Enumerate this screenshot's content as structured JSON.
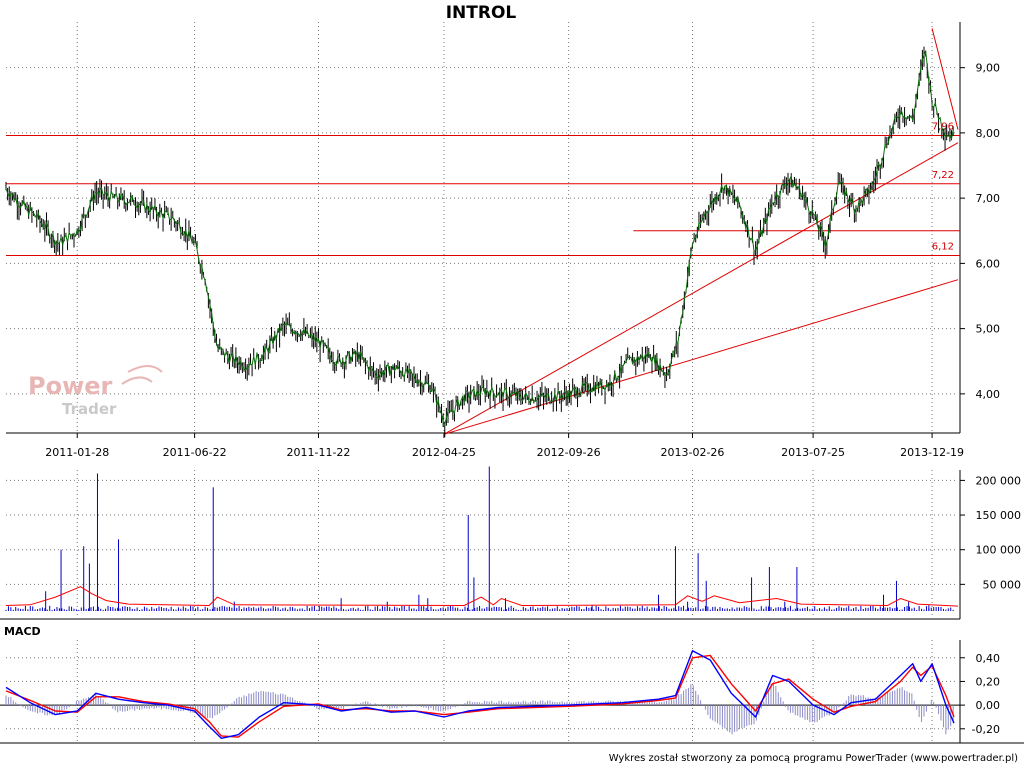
{
  "title": "INTROL",
  "footer": "Wykres został stworzony za pomocą programu PowerTrader (www.powertrader.pl)",
  "logo": {
    "line1": "Power",
    "line2": "Trader"
  },
  "macd_label": "MACD",
  "colors": {
    "price": "#0a6e0a",
    "level": "#e00000",
    "volume": "#0000c8",
    "volume_avg": "#ff0000",
    "macd": "#0000ff",
    "signal": "#ff0000",
    "hist": "#8c8cc8",
    "grid": "#777777"
  },
  "chart_data": [
    {
      "name": "price",
      "type": "line",
      "x_ticks": [
        "2011-01-28",
        "2011-06-22",
        "2011-11-22",
        "2012-04-25",
        "2012-09-26",
        "2013-02-26",
        "2013-07-25",
        "2013-12-19"
      ],
      "y_ticks": [
        "4,00",
        "5,00",
        "6,00",
        "7,00",
        "8,00",
        "9,00"
      ],
      "ylim": [
        3.4,
        9.7
      ],
      "xlim": [
        "2010-11-01",
        "2014-01-20"
      ],
      "series": [
        {
          "x": [
            "2010-11-01",
            "2010-11-20",
            "2010-12-10",
            "2011-01-05",
            "2011-01-28",
            "2011-02-20",
            "2011-03-15",
            "2011-04-10",
            "2011-05-05",
            "2011-05-25",
            "2011-06-10",
            "2011-06-22",
            "2011-07-05",
            "2011-07-20",
            "2011-08-05",
            "2011-08-25",
            "2011-09-15",
            "2011-10-10",
            "2011-11-01",
            "2011-11-22",
            "2011-12-15",
            "2012-01-10",
            "2012-02-01",
            "2012-02-25",
            "2012-03-20",
            "2012-04-10",
            "2012-04-25",
            "2012-05-20",
            "2012-06-15",
            "2012-07-10",
            "2012-08-05",
            "2012-08-30",
            "2012-09-26",
            "2012-10-20",
            "2012-11-15",
            "2012-12-10",
            "2013-01-05",
            "2013-01-25",
            "2013-02-08",
            "2013-02-26",
            "2013-03-15",
            "2013-04-05",
            "2013-04-25",
            "2013-05-15",
            "2013-06-05",
            "2013-06-25",
            "2013-07-10",
            "2013-07-25",
            "2013-08-10",
            "2013-08-25",
            "2013-09-15",
            "2013-10-05",
            "2013-10-25",
            "2013-11-10",
            "2013-11-25",
            "2013-12-10",
            "2013-12-19",
            "2014-01-05",
            "2014-01-15"
          ],
          "y": [
            7.15,
            6.9,
            6.7,
            6.3,
            6.5,
            7.1,
            7.0,
            6.95,
            6.8,
            6.7,
            6.5,
            6.3,
            5.8,
            4.7,
            4.55,
            4.45,
            4.6,
            5.05,
            4.95,
            4.8,
            4.5,
            4.6,
            4.3,
            4.4,
            4.25,
            4.1,
            3.6,
            3.95,
            4.05,
            4.0,
            3.95,
            3.95,
            4.0,
            4.1,
            4.15,
            4.5,
            4.6,
            4.3,
            4.8,
            6.3,
            6.8,
            7.2,
            6.9,
            6.2,
            6.95,
            7.3,
            7.1,
            6.75,
            6.3,
            7.25,
            6.85,
            7.15,
            7.9,
            8.35,
            8.2,
            9.3,
            8.5,
            8.0,
            7.96
          ]
        }
      ],
      "levels": [
        {
          "value": 7.96,
          "label": "7,96"
        },
        {
          "value": 7.22,
          "label": "7,22"
        },
        {
          "value": 6.12,
          "label": "6,12"
        }
      ],
      "extra_levels": [
        6.5
      ],
      "trendlines": [
        {
          "from": [
            "2012-04-25",
            3.38
          ],
          "to": [
            "2014-01-20",
            7.85
          ]
        },
        {
          "from": [
            "2012-04-25",
            3.38
          ],
          "to": [
            "2014-01-20",
            5.75
          ]
        },
        {
          "from": [
            "2013-12-19",
            9.6
          ],
          "to": [
            "2014-01-20",
            8.05
          ]
        }
      ]
    },
    {
      "name": "volume",
      "type": "bar",
      "y_ticks": [
        "50 000",
        "100 000",
        "150 000",
        "200 000"
      ],
      "ylim": [
        0,
        215000
      ],
      "spikes": [
        {
          "x": "2010-12-20",
          "v": 40000
        },
        {
          "x": "2011-01-08",
          "v": 100000
        },
        {
          "x": "2011-02-05",
          "v": 105000
        },
        {
          "x": "2011-02-12",
          "v": 80000
        },
        {
          "x": "2011-02-22",
          "v": 210000
        },
        {
          "x": "2011-03-20",
          "v": 115000
        },
        {
          "x": "2011-07-15",
          "v": 190000
        },
        {
          "x": "2011-08-10",
          "v": 25000
        },
        {
          "x": "2011-12-20",
          "v": 30000
        },
        {
          "x": "2012-02-15",
          "v": 25000
        },
        {
          "x": "2012-03-25",
          "v": 35000
        },
        {
          "x": "2012-04-05",
          "v": 30000
        },
        {
          "x": "2012-05-25",
          "v": 150000
        },
        {
          "x": "2012-06-01",
          "v": 60000
        },
        {
          "x": "2012-06-20",
          "v": 220000
        },
        {
          "x": "2012-07-10",
          "v": 30000
        },
        {
          "x": "2012-10-25",
          "v": 20000
        },
        {
          "x": "2013-01-15",
          "v": 35000
        },
        {
          "x": "2013-02-05",
          "v": 105000
        },
        {
          "x": "2013-02-20",
          "v": 25000
        },
        {
          "x": "2013-03-05",
          "v": 95000
        },
        {
          "x": "2013-03-15",
          "v": 55000
        },
        {
          "x": "2013-05-10",
          "v": 60000
        },
        {
          "x": "2013-06-01",
          "v": 75000
        },
        {
          "x": "2013-06-20",
          "v": 25000
        },
        {
          "x": "2013-07-05",
          "v": 75000
        },
        {
          "x": "2013-10-20",
          "v": 35000
        },
        {
          "x": "2013-11-05",
          "v": 55000
        },
        {
          "x": "2013-11-20",
          "v": 25000
        },
        {
          "x": "2013-12-15",
          "v": 20000
        }
      ],
      "avg": [
        {
          "x": "2010-11-01",
          "v": 8000
        },
        {
          "x": "2010-12-01",
          "v": 9000
        },
        {
          "x": "2011-01-01",
          "v": 20000
        },
        {
          "x": "2011-02-01",
          "v": 35000
        },
        {
          "x": "2011-02-15",
          "v": 25000
        },
        {
          "x": "2011-03-05",
          "v": 15000
        },
        {
          "x": "2011-04-01",
          "v": 10000
        },
        {
          "x": "2011-07-10",
          "v": 8000
        },
        {
          "x": "2011-07-20",
          "v": 20000
        },
        {
          "x": "2011-08-10",
          "v": 9000
        },
        {
          "x": "2012-05-20",
          "v": 8000
        },
        {
          "x": "2012-06-10",
          "v": 20000
        },
        {
          "x": "2012-06-25",
          "v": 9000
        },
        {
          "x": "2012-07-05",
          "v": 18000
        },
        {
          "x": "2012-07-30",
          "v": 8000
        },
        {
          "x": "2013-02-05",
          "v": 9000
        },
        {
          "x": "2013-02-20",
          "v": 22000
        },
        {
          "x": "2013-03-10",
          "v": 14000
        },
        {
          "x": "2013-03-25",
          "v": 22000
        },
        {
          "x": "2013-04-25",
          "v": 12000
        },
        {
          "x": "2013-06-10",
          "v": 18000
        },
        {
          "x": "2013-07-10",
          "v": 10000
        },
        {
          "x": "2013-10-25",
          "v": 8000
        },
        {
          "x": "2013-11-10",
          "v": 18000
        },
        {
          "x": "2013-12-01",
          "v": 10000
        },
        {
          "x": "2014-01-20",
          "v": 7000
        }
      ]
    },
    {
      "name": "MACD",
      "type": "line",
      "y_ticks": [
        "-0,20",
        "0,00",
        "0,20",
        "0,40"
      ],
      "ylim": [
        -0.32,
        0.55
      ],
      "series": [
        {
          "name": "",
          "x": [
            "2010-11-01",
            "2010-12-01",
            "2011-01-01",
            "2011-01-28",
            "2011-02-20",
            "2011-03-20",
            "2011-04-20",
            "2011-05-20",
            "2011-06-22",
            "2011-07-10",
            "2011-07-25",
            "2011-08-15",
            "2011-09-10",
            "2011-10-10",
            "2011-11-22",
            "2011-12-20",
            "2012-01-20",
            "2012-02-20",
            "2012-03-20",
            "2012-04-25",
            "2012-05-25",
            "2012-07-01",
            "2012-09-26",
            "2012-12-01",
            "2013-01-15",
            "2013-02-05",
            "2013-02-26",
            "2013-03-20",
            "2013-04-15",
            "2013-05-15",
            "2013-06-05",
            "2013-06-25",
            "2013-07-25",
            "2013-08-20",
            "2013-09-10",
            "2013-10-10",
            "2013-11-10",
            "2013-11-25",
            "2013-12-05",
            "2013-12-19",
            "2014-01-05",
            "2014-01-15"
          ],
          "values": [
            0.15,
            0.02,
            -0.08,
            -0.05,
            0.1,
            0.05,
            0.02,
            0.0,
            -0.05,
            -0.18,
            -0.28,
            -0.25,
            -0.1,
            0.02,
            0.0,
            -0.05,
            -0.02,
            -0.06,
            -0.05,
            -0.1,
            -0.05,
            -0.02,
            0.0,
            0.02,
            0.05,
            0.08,
            0.46,
            0.38,
            0.1,
            -0.1,
            0.25,
            0.2,
            0.0,
            -0.08,
            0.02,
            0.05,
            0.25,
            0.35,
            0.2,
            0.35,
            0.0,
            -0.15
          ]
        },
        {
          "name": "",
          "x": [
            "2010-11-01",
            "2010-12-01",
            "2011-01-01",
            "2011-01-28",
            "2011-02-20",
            "2011-03-20",
            "2011-04-20",
            "2011-05-20",
            "2011-06-22",
            "2011-07-10",
            "2011-07-25",
            "2011-08-15",
            "2011-09-10",
            "2011-10-10",
            "2011-11-22",
            "2011-12-20",
            "2012-01-20",
            "2012-02-20",
            "2012-03-20",
            "2012-04-25",
            "2012-05-25",
            "2012-07-01",
            "2012-09-26",
            "2012-12-01",
            "2013-01-15",
            "2013-02-05",
            "2013-02-26",
            "2013-03-20",
            "2013-04-15",
            "2013-05-15",
            "2013-06-05",
            "2013-06-25",
            "2013-07-25",
            "2013-08-20",
            "2013-09-10",
            "2013-10-10",
            "2013-11-10",
            "2013-11-25",
            "2013-12-05",
            "2013-12-19",
            "2014-01-05",
            "2014-01-15"
          ],
          "values": [
            0.12,
            0.04,
            -0.05,
            -0.06,
            0.07,
            0.07,
            0.03,
            0.01,
            -0.03,
            -0.14,
            -0.26,
            -0.27,
            -0.14,
            -0.01,
            0.01,
            -0.04,
            -0.03,
            -0.05,
            -0.05,
            -0.08,
            -0.06,
            -0.03,
            -0.01,
            0.01,
            0.04,
            0.06,
            0.4,
            0.42,
            0.18,
            -0.05,
            0.18,
            0.22,
            0.05,
            -0.06,
            -0.01,
            0.03,
            0.2,
            0.32,
            0.25,
            0.33,
            0.08,
            -0.1
          ]
        }
      ]
    }
  ]
}
